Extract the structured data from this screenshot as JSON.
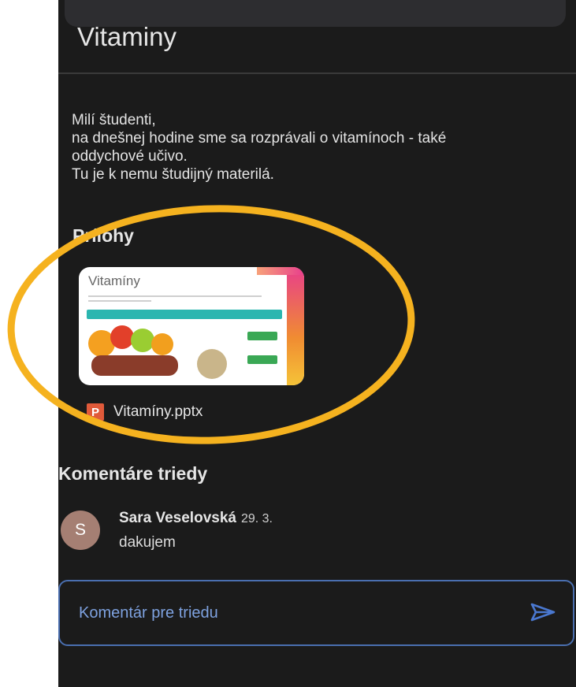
{
  "post": {
    "title": "Vitaminy",
    "description_lines": [
      "Milí študenti,",
      "na dnešnej hodine sme sa rozprávali o vitamínoch - také",
      "oddychové učivo.",
      "Tu je k nemu študijný materilá."
    ]
  },
  "attachments": {
    "heading": "Prílohy",
    "items": [
      {
        "slide_title": "Vitamíny",
        "file_name": "Vitamíny.pptx",
        "file_type_icon": "P",
        "icon": "powerpoint-icon"
      }
    ]
  },
  "comments": {
    "heading": "Komentáre triedy",
    "items": [
      {
        "avatar_letter": "S",
        "author": "Sara Veselovská",
        "date": "29. 3.",
        "text": "dakujem"
      }
    ],
    "input": {
      "placeholder": "Komentár pre triedu",
      "value": ""
    },
    "send_icon": "send-icon"
  },
  "colors": {
    "background": "#1b1b1b",
    "accent": "#7ea2e0",
    "highlight": "#f5b21f",
    "avatar": "#a57f73",
    "ppt": "#e05a3a"
  }
}
